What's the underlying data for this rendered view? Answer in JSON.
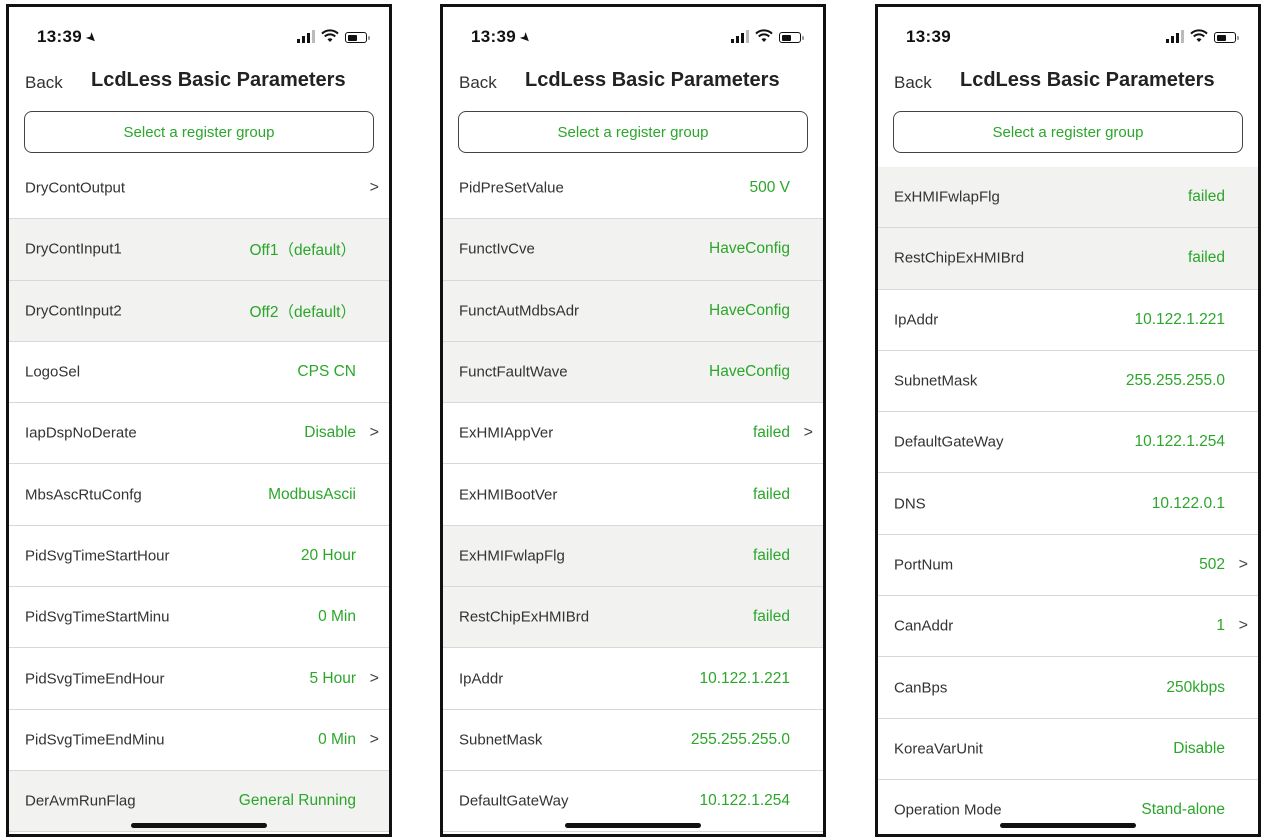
{
  "colors": {
    "accent": "#2ba62b",
    "shaded_row": "#f2f2f0",
    "divider": "#d8d8d8"
  },
  "screens": [
    {
      "time": "13:39",
      "location_arrow": true,
      "back": "Back",
      "title": "LcdLess Basic Parameters",
      "group_button": "Select a register group",
      "rows": [
        {
          "label": "DryContOutput",
          "value": "",
          "chevron": true,
          "shaded": false
        },
        {
          "label": "DryContInput1",
          "value": "Off1（default）",
          "chevron": false,
          "shaded": true
        },
        {
          "label": "DryContInput2",
          "value": "Off2（default）",
          "chevron": false,
          "shaded": true
        },
        {
          "label": "LogoSel",
          "value": "CPS CN",
          "chevron": false,
          "shaded": false
        },
        {
          "label": "IapDspNoDerate",
          "value": "Disable",
          "chevron": true,
          "shaded": false
        },
        {
          "label": "MbsAscRtuConfg",
          "value": "ModbusAscii",
          "chevron": false,
          "shaded": false
        },
        {
          "label": "PidSvgTimeStartHour",
          "value": "20 Hour",
          "chevron": false,
          "shaded": false
        },
        {
          "label": "PidSvgTimeStartMinu",
          "value": "0 Min",
          "chevron": false,
          "shaded": false
        },
        {
          "label": "PidSvgTimeEndHour",
          "value": "5 Hour",
          "chevron": true,
          "shaded": false
        },
        {
          "label": "PidSvgTimeEndMinu",
          "value": "0 Min",
          "chevron": true,
          "shaded": false
        },
        {
          "label": "DerAvmRunFlag",
          "value": "General Running",
          "chevron": false,
          "shaded": true
        }
      ]
    },
    {
      "time": "13:39",
      "location_arrow": true,
      "back": "Back",
      "title": "LcdLess Basic Parameters",
      "group_button": "Select a register group",
      "rows": [
        {
          "label": "PidPreSetValue",
          "value": "500 V",
          "chevron": false,
          "shaded": false
        },
        {
          "label": "FunctIvCve",
          "value": "HaveConfig",
          "chevron": false,
          "shaded": true
        },
        {
          "label": "FunctAutMdbsAdr",
          "value": "HaveConfig",
          "chevron": false,
          "shaded": true
        },
        {
          "label": "FunctFaultWave",
          "value": "HaveConfig",
          "chevron": false,
          "shaded": true
        },
        {
          "label": "ExHMIAppVer",
          "value": "failed",
          "chevron": true,
          "shaded": false
        },
        {
          "label": "ExHMIBootVer",
          "value": "failed",
          "chevron": false,
          "shaded": false
        },
        {
          "label": "ExHMIFwlapFlg",
          "value": "failed",
          "chevron": false,
          "shaded": true
        },
        {
          "label": "RestChipExHMIBrd",
          "value": "failed",
          "chevron": false,
          "shaded": true
        },
        {
          "label": "IpAddr",
          "value": "10.122.1.221",
          "chevron": false,
          "shaded": false
        },
        {
          "label": "SubnetMask",
          "value": "255.255.255.0",
          "chevron": false,
          "shaded": false
        },
        {
          "label": "DefaultGateWay",
          "value": "10.122.1.254",
          "chevron": false,
          "shaded": false
        }
      ]
    },
    {
      "time": "13:39",
      "location_arrow": false,
      "back": "Back",
      "title": "LcdLess Basic Parameters",
      "group_button": "Select a register group",
      "rows": [
        {
          "label": "ExHMIFwlapFlg",
          "value": "failed",
          "chevron": false,
          "shaded": true
        },
        {
          "label": "RestChipExHMIBrd",
          "value": "failed",
          "chevron": false,
          "shaded": true
        },
        {
          "label": "IpAddr",
          "value": "10.122.1.221",
          "chevron": false,
          "shaded": false
        },
        {
          "label": "SubnetMask",
          "value": "255.255.255.0",
          "chevron": false,
          "shaded": false
        },
        {
          "label": "DefaultGateWay",
          "value": "10.122.1.254",
          "chevron": false,
          "shaded": false
        },
        {
          "label": "DNS",
          "value": "10.122.0.1",
          "chevron": false,
          "shaded": false
        },
        {
          "label": "PortNum",
          "value": "502",
          "chevron": true,
          "shaded": false
        },
        {
          "label": "CanAddr",
          "value": "1",
          "chevron": true,
          "shaded": false
        },
        {
          "label": "CanBps",
          "value": "250kbps",
          "chevron": false,
          "shaded": false
        },
        {
          "label": "KoreaVarUnit",
          "value": "Disable",
          "chevron": false,
          "shaded": false
        },
        {
          "label": "Operation Mode",
          "value": "Stand-alone",
          "chevron": false,
          "shaded": false
        }
      ]
    }
  ]
}
